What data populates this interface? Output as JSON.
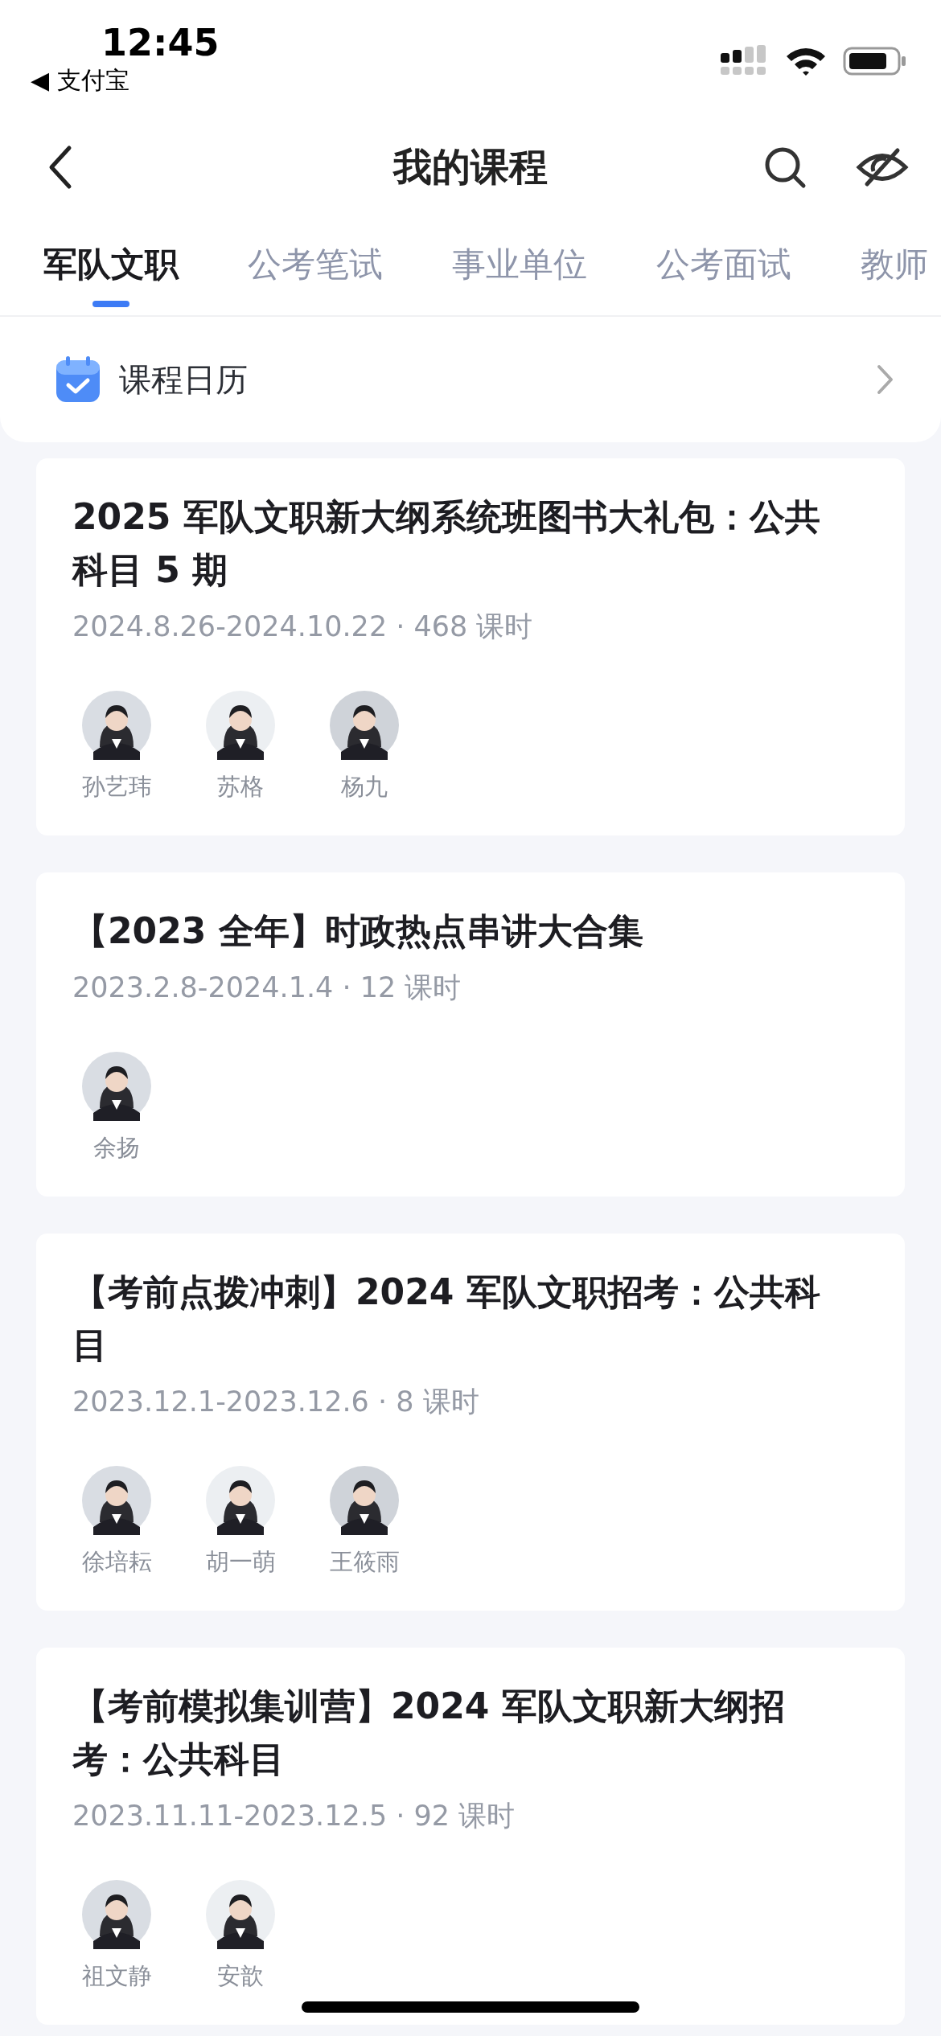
{
  "status_bar": {
    "time": "12:45",
    "back_app": "◀ 支付宝"
  },
  "header": {
    "title": "我的课程"
  },
  "tabs": [
    {
      "label": "军队文职",
      "selected": true
    },
    {
      "label": "公考笔试",
      "selected": false
    },
    {
      "label": "事业单位",
      "selected": false
    },
    {
      "label": "公考面试",
      "selected": false
    },
    {
      "label": "教师",
      "selected": false
    }
  ],
  "calendar_row": {
    "label": "课程日历"
  },
  "courses": [
    {
      "title": "2025 军队文职新大纲系统班图书大礼包：公共科目 5 期",
      "meta": "2024.8.26-2024.10.22 · 468 课时",
      "teachers": [
        "孙艺玮",
        "苏格",
        "杨九"
      ]
    },
    {
      "title": "【2023 全年】时政热点串讲大合集",
      "meta": "2023.2.8-2024.1.4 · 12 课时",
      "teachers": [
        "余扬"
      ]
    },
    {
      "title": "【考前点拨冲刺】2024 军队文职招考：公共科目",
      "meta": "2023.12.1-2023.12.6 · 8 课时",
      "teachers": [
        "徐培耘",
        "胡一萌",
        "王筱雨"
      ]
    },
    {
      "title": "【考前模拟集训营】2024 军队文职新大纲招考：公共科目",
      "meta": "2023.11.11-2023.12.5 · 92 课时",
      "teachers": [
        "祖文静",
        "安歆"
      ]
    }
  ]
}
